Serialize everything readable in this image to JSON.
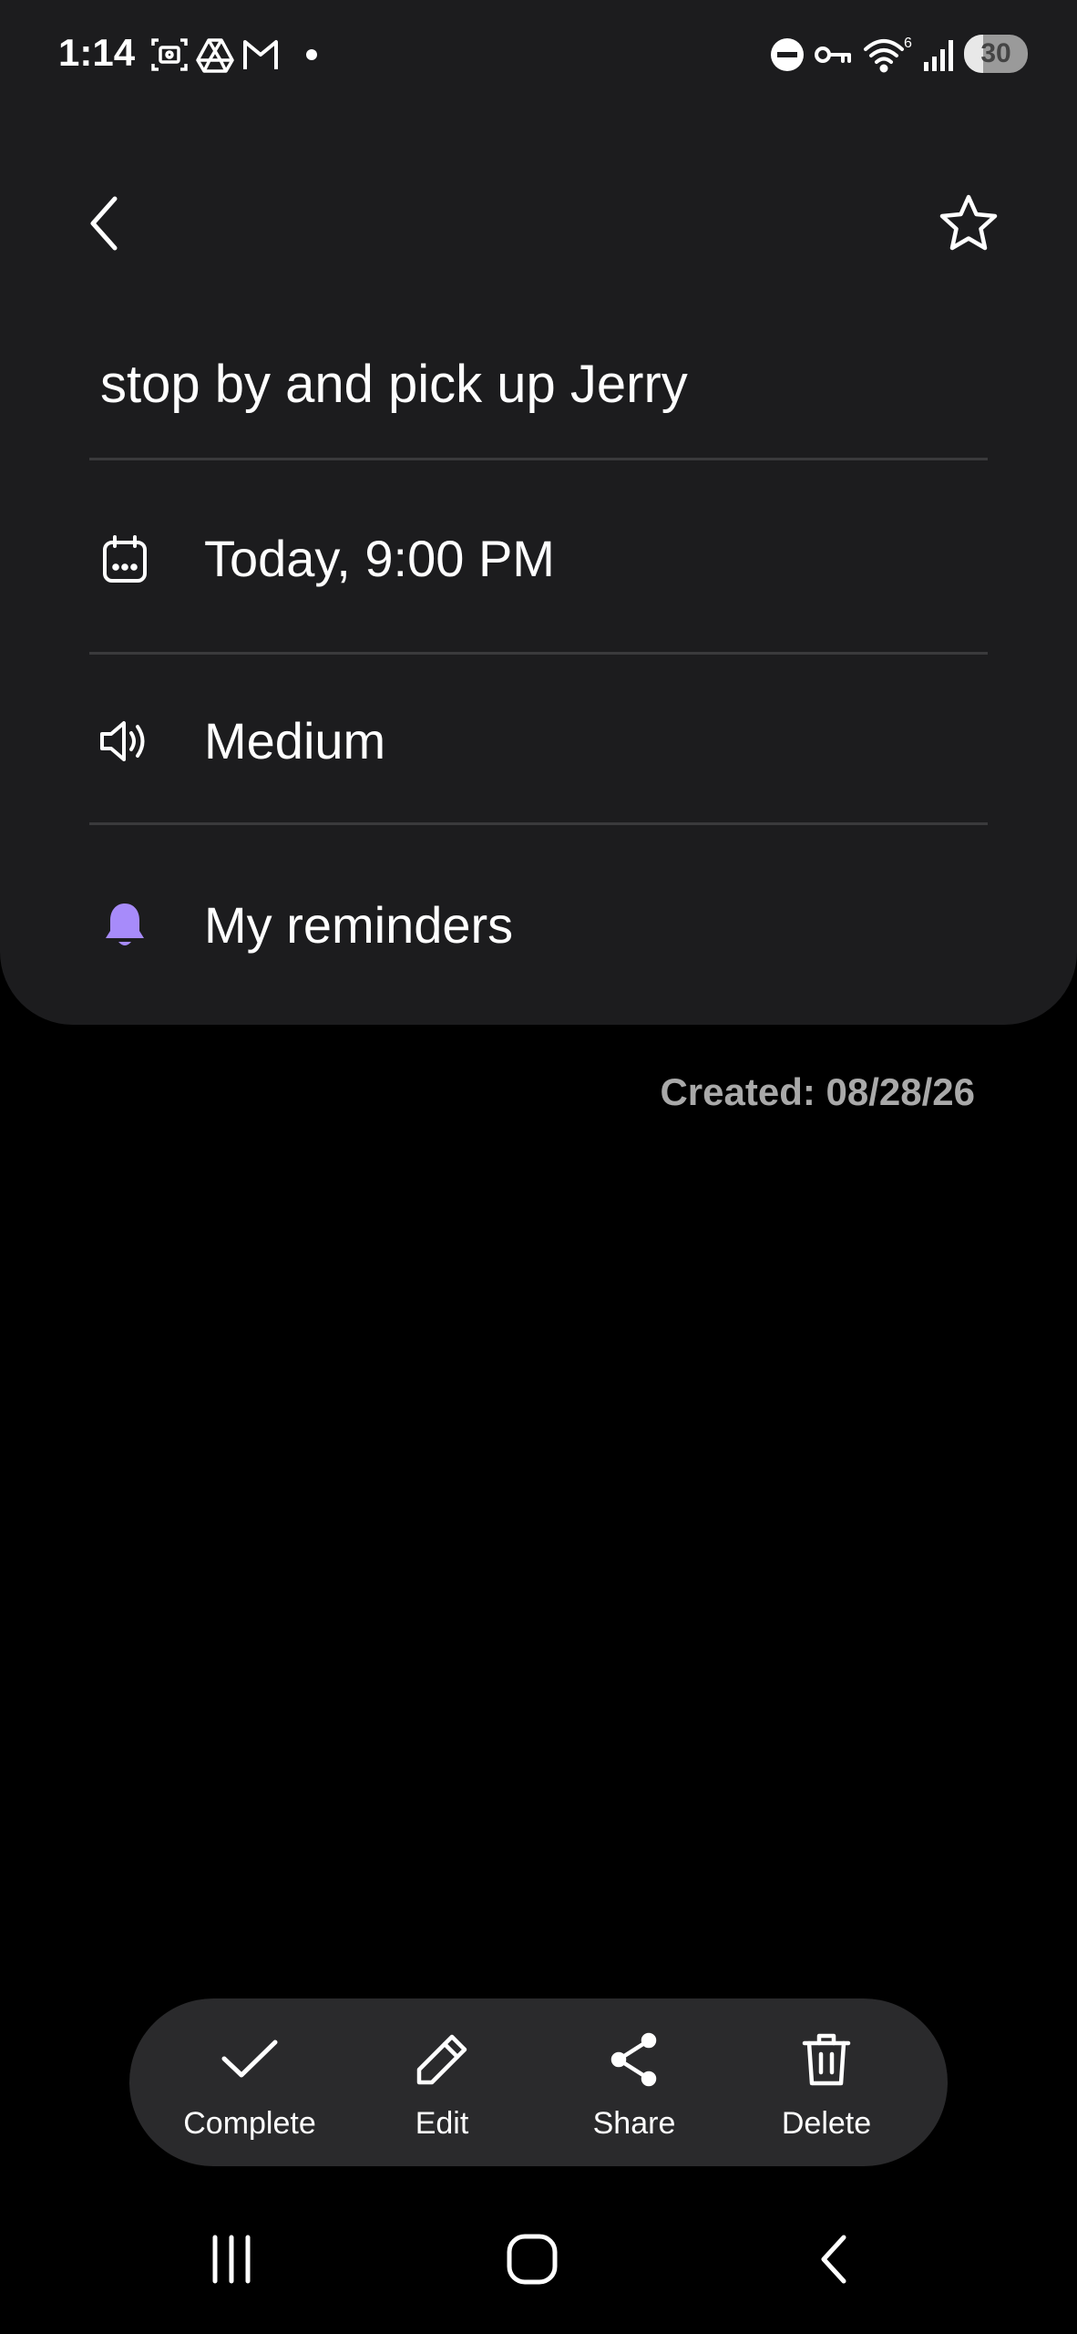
{
  "status_bar": {
    "time": "1:14",
    "notification_icons": [
      "screenshot-icon",
      "drive-icon",
      "gmail-icon",
      "dot-icon"
    ],
    "system_icons": [
      "do-not-disturb-icon",
      "vpn-key-icon",
      "wifi-icon",
      "signal-icon"
    ],
    "wifi_badge": "6",
    "battery_level": "30",
    "battery_fraction": 0.3
  },
  "header": {
    "back_icon": "chevron-left-icon",
    "favorite_icon": "star-outline-icon"
  },
  "reminder": {
    "title": "stop by and pick up Jerry",
    "datetime": "Today, 9:00 PM",
    "alert_style": "Medium",
    "category": "My reminders",
    "category_color": "#a78bfa",
    "created": "Created: 08/28/26"
  },
  "toolbar": {
    "complete_label": "Complete",
    "edit_label": "Edit",
    "share_label": "Share",
    "delete_label": "Delete"
  },
  "nav_bar": {
    "recents_icon": "recents-icon",
    "home_icon": "home-icon",
    "back_icon": "back-icon"
  },
  "colors": {
    "background": "#000000",
    "card": "#1c1c1e",
    "toolbar": "#2a2a2c",
    "text": "#ffffff",
    "muted_text": "#a9a9a9",
    "accent": "#a78bfa"
  }
}
